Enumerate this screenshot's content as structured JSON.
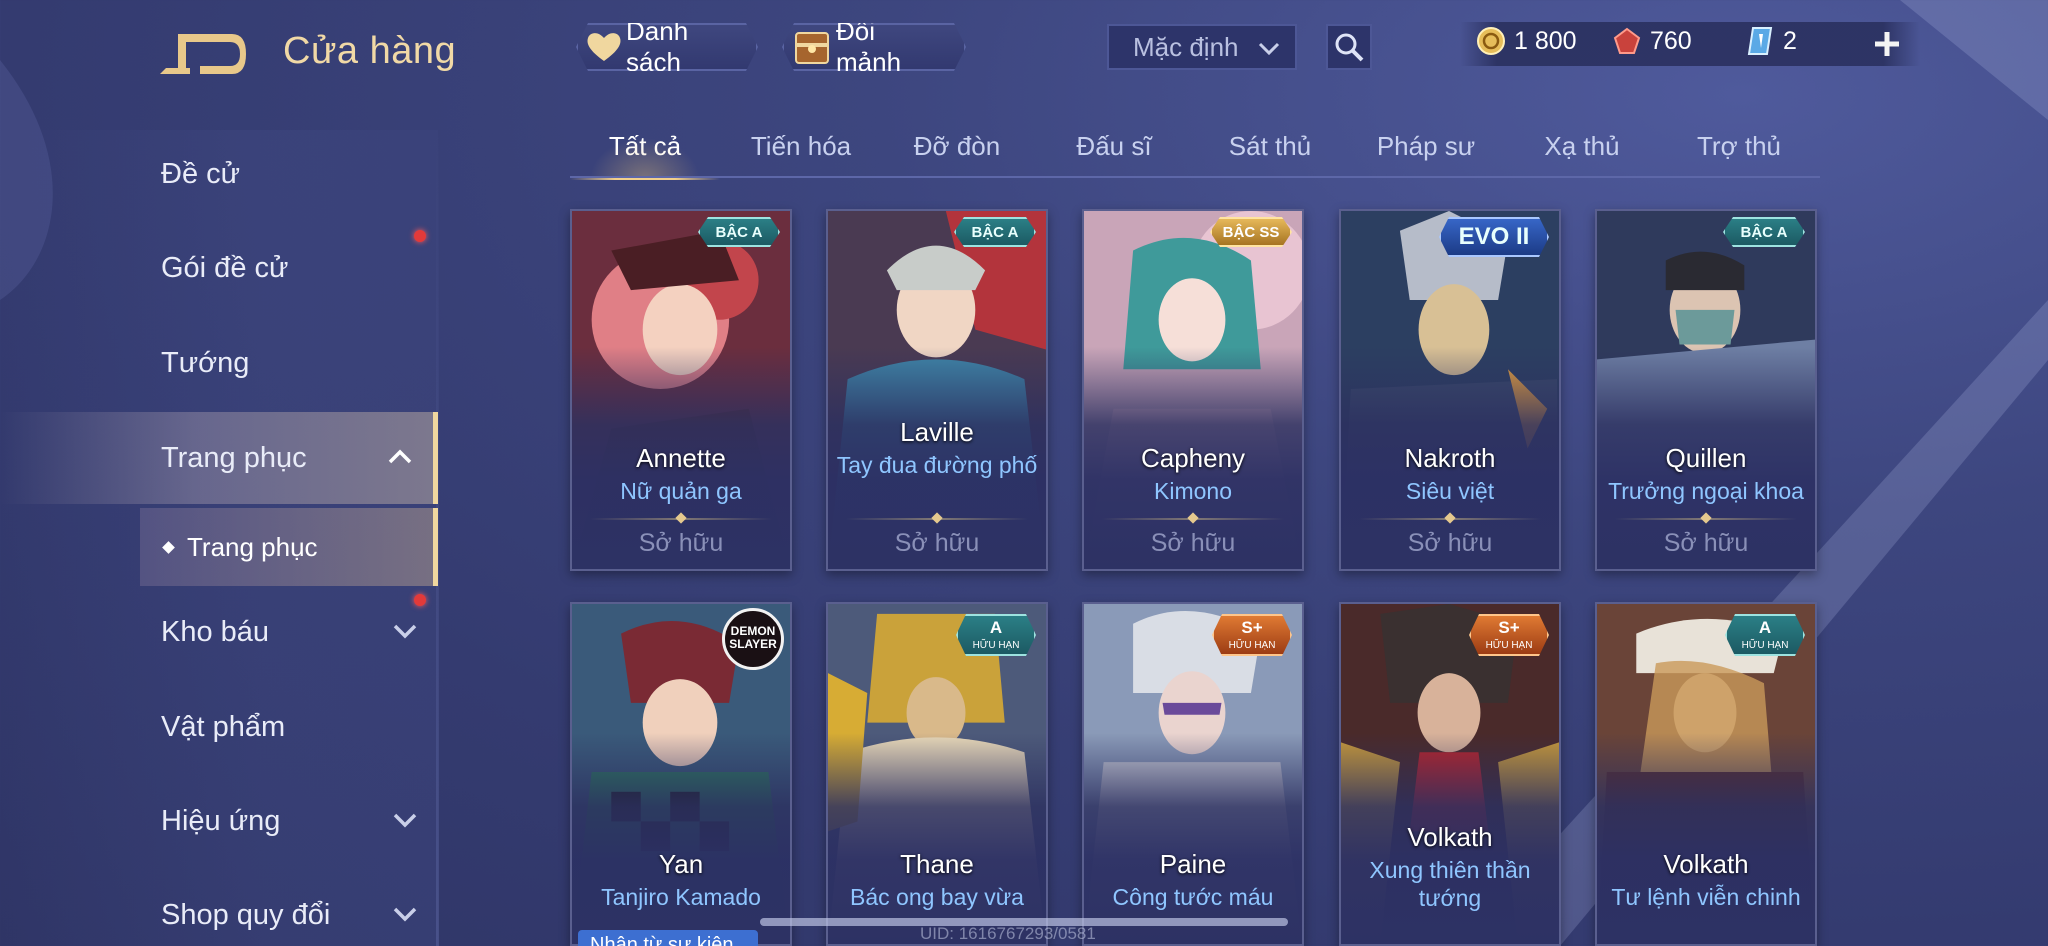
{
  "header": {
    "title": "Cửa hàng",
    "list_button": "Danh sách",
    "exchange_button": "Đổi mảnh",
    "sort_value": "Mặc định"
  },
  "currency": {
    "gold": "1 800",
    "ruby": "760",
    "voucher": "2"
  },
  "sidebar": {
    "items": [
      {
        "label": "Đề cử"
      },
      {
        "label": "Gói đề cử"
      },
      {
        "label": "Tướng"
      },
      {
        "label": "Trang phục"
      },
      {
        "label": "Kho báu"
      },
      {
        "label": "Vật phẩm"
      },
      {
        "label": "Hiệu ứng"
      },
      {
        "label": "Shop quy đổi"
      }
    ],
    "sub_item": "Trang phục"
  },
  "tabs": [
    "Tất cả",
    "Tiến hóa",
    "Đỡ đòn",
    "Đấu sĩ",
    "Sát thủ",
    "Pháp sư",
    "Xạ thủ",
    "Trợ thủ"
  ],
  "cards_row1": [
    {
      "hero": "Annette",
      "skin": "Nữ quản ga",
      "status": "Sở hữu",
      "badge": "BẬC A"
    },
    {
      "hero": "Laville",
      "skin": "Tay đua đường phố",
      "status": "Sở hữu",
      "badge": "BẬC A"
    },
    {
      "hero": "Capheny",
      "skin": "Kimono",
      "status": "Sở hữu",
      "badge": "BẬC SS"
    },
    {
      "hero": "Nakroth",
      "skin": "Siêu việt",
      "status": "Sở hữu",
      "badge": "EVO II"
    },
    {
      "hero": "Quillen",
      "skin": "Trưởng ngoại khoa",
      "status": "Sở hữu",
      "badge": "BẬC A"
    }
  ],
  "cards_row2": [
    {
      "hero": "Yan",
      "skin": "Tanjiro Kamado",
      "badge": "DEMON SLAYER"
    },
    {
      "hero": "Thane",
      "skin": "Bác ong bay vừa",
      "badge": "A",
      "badge_sub": "HỮU HẠN"
    },
    {
      "hero": "Paine",
      "skin": "Công tước máu",
      "badge": "S+",
      "badge_sub": "HỮU HẠN"
    },
    {
      "hero": "Volkath",
      "skin": "Xung thiên thần tướng",
      "badge": "S+",
      "badge_sub": "HỮU HẠN"
    },
    {
      "hero": "Volkath",
      "skin": "Tư lệnh viễn chinh",
      "badge": "A",
      "badge_sub": "HỮU HẠN"
    }
  ],
  "footer": {
    "uid": "UID: 1616767293/0581",
    "bottom_tag": "Nhận từ sự kiện"
  },
  "colors": {
    "accent_gold": "#f0d79f",
    "skin_blue": "#8fc6ff",
    "notification_red": "#e23a3a"
  }
}
